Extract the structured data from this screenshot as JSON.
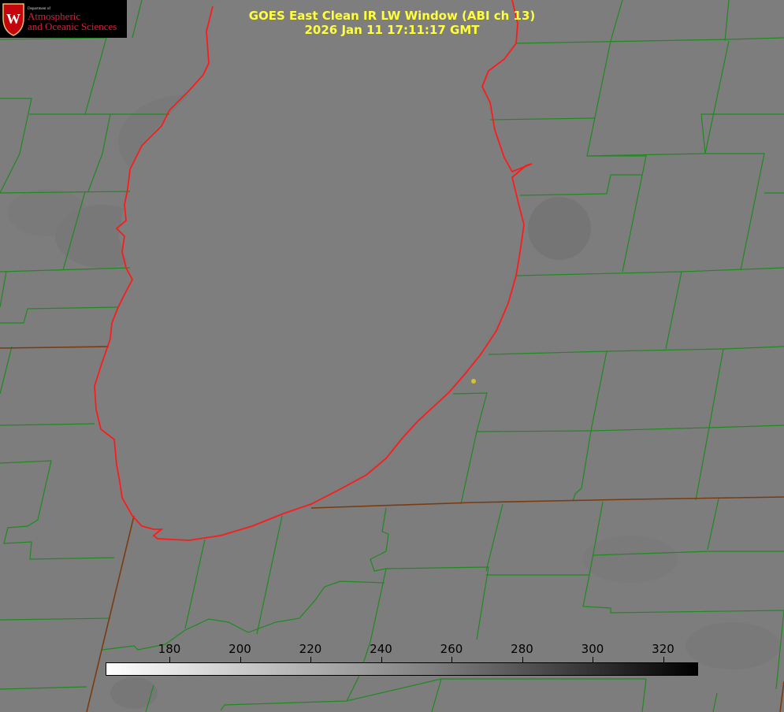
{
  "title_line1": "GOES East Clean IR LW Window (ABI ch 13)",
  "title_line2": "2026 Jan 11 17:11:17 GMT",
  "logo": {
    "department": "Department of",
    "line1": "Atmospheric",
    "line2": "and Oceanic Sciences",
    "crest_letter": "W"
  },
  "colorbar": {
    "ticks": [
      "180",
      "200",
      "220",
      "240",
      "260",
      "280",
      "300",
      "320"
    ]
  },
  "colors": {
    "background": "#7d7d7d",
    "county_lines": "#1f8a1f",
    "coastline": "#ff1a1a",
    "title": "#ffff3c",
    "marker": "#d4c428"
  }
}
